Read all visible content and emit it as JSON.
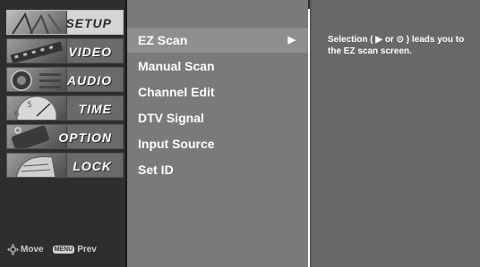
{
  "categories": [
    {
      "label": "SETUP",
      "icon": "setup-icon"
    },
    {
      "label": "VIDEO",
      "icon": "film-icon"
    },
    {
      "label": "AUDIO",
      "icon": "speaker-icon"
    },
    {
      "label": "TIME",
      "icon": "clock-icon"
    },
    {
      "label": "OPTION",
      "icon": "option-icon"
    },
    {
      "label": "LOCK",
      "icon": "lock-icon"
    }
  ],
  "active_category": "SETUP",
  "menu_items": [
    {
      "label": "EZ Scan",
      "selected": true,
      "arrow": "▶"
    },
    {
      "label": "Manual Scan"
    },
    {
      "label": "Channel Edit"
    },
    {
      "label": "DTV Signal"
    },
    {
      "label": "Input Source"
    },
    {
      "label": "Set ID"
    }
  ],
  "help_text": "Selection ( ▶ or ⊙ ) leads you to the EZ scan screen.",
  "nav_hint": {
    "move_label": "Move",
    "menu_key": "MENU",
    "prev_label": "Prev"
  },
  "colors": {
    "sidebar_bg": "#2e2e2e",
    "menu_bg": "#7a7a7a",
    "help_bg": "#686868",
    "active_tab": "#d6d6d6"
  }
}
